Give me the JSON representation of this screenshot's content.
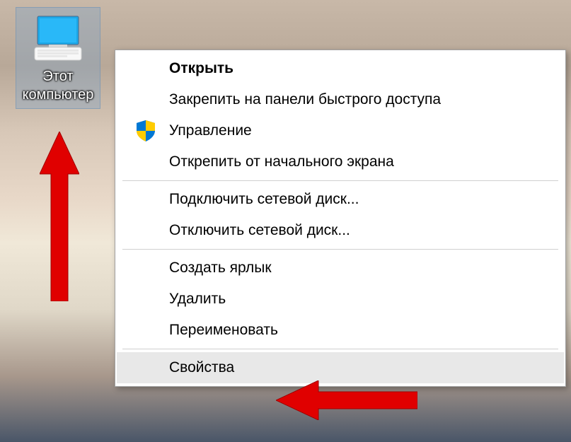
{
  "desktop": {
    "icon_label": "Этот компьютер"
  },
  "context_menu": {
    "items": [
      {
        "label": "Открыть",
        "bold": true,
        "icon": null
      },
      {
        "label": "Закрепить на панели быстрого доступа",
        "bold": false,
        "icon": null
      },
      {
        "label": "Управление",
        "bold": false,
        "icon": "shield"
      },
      {
        "label": "Открепить от начального экрана",
        "bold": false,
        "icon": null
      }
    ],
    "items2": [
      {
        "label": "Подключить сетевой диск...",
        "bold": false,
        "icon": null
      },
      {
        "label": "Отключить сетевой диск...",
        "bold": false,
        "icon": null
      }
    ],
    "items3": [
      {
        "label": "Создать ярлык",
        "bold": false,
        "icon": null
      },
      {
        "label": "Удалить",
        "bold": false,
        "icon": null
      },
      {
        "label": "Переименовать",
        "bold": false,
        "icon": null
      }
    ],
    "items4": [
      {
        "label": "Свойства",
        "bold": false,
        "icon": null,
        "highlighted": true
      }
    ]
  },
  "annotations": {
    "arrow_color": "#e00000"
  }
}
